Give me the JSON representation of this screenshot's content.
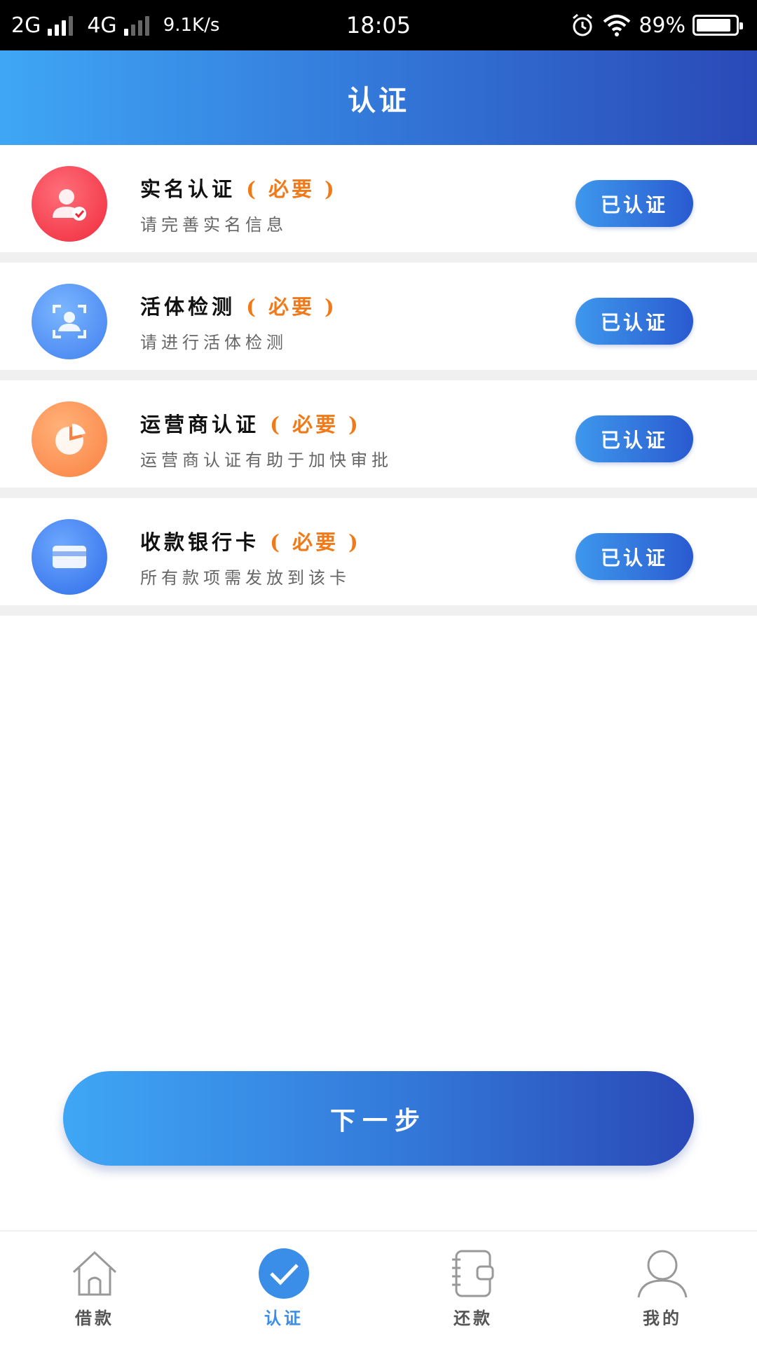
{
  "status_bar": {
    "net1": "2G",
    "net2": "4G",
    "speed": "9.1K/s",
    "time": "18:05",
    "battery": "89%",
    "battery_level": 0.89
  },
  "header": {
    "title": "认证"
  },
  "items": [
    {
      "title": "实名认证",
      "required": "( 必要 )",
      "subtitle": "请完善实名信息",
      "status": "已认证",
      "icon": "person-check-icon",
      "color": "#f02a3c"
    },
    {
      "title": "活体检测",
      "required": "( 必要 )",
      "subtitle": "请进行活体检测",
      "status": "已认证",
      "icon": "face-scan-icon",
      "color": "#3f7fef"
    },
    {
      "title": "运营商认证",
      "required": "( 必要 )",
      "subtitle": "运营商认证有助于加快审批",
      "status": "已认证",
      "icon": "pie-chart-icon",
      "color": "#fb8041"
    },
    {
      "title": "收款银行卡",
      "required": "( 必要 )",
      "subtitle": "所有款项需发放到该卡",
      "status": "已认证",
      "icon": "bank-card-icon",
      "color": "#2d6de8"
    }
  ],
  "next_button": {
    "label": "下一步"
  },
  "tabbar": {
    "tabs": [
      {
        "label": "借款",
        "icon": "home-icon"
      },
      {
        "label": "认证",
        "icon": "check-circle-icon",
        "active": true
      },
      {
        "label": "还款",
        "icon": "wallet-book-icon"
      },
      {
        "label": "我的",
        "icon": "user-icon"
      }
    ]
  },
  "colors": {
    "accent": "#3a8ee8",
    "required": "#f07a1a"
  }
}
